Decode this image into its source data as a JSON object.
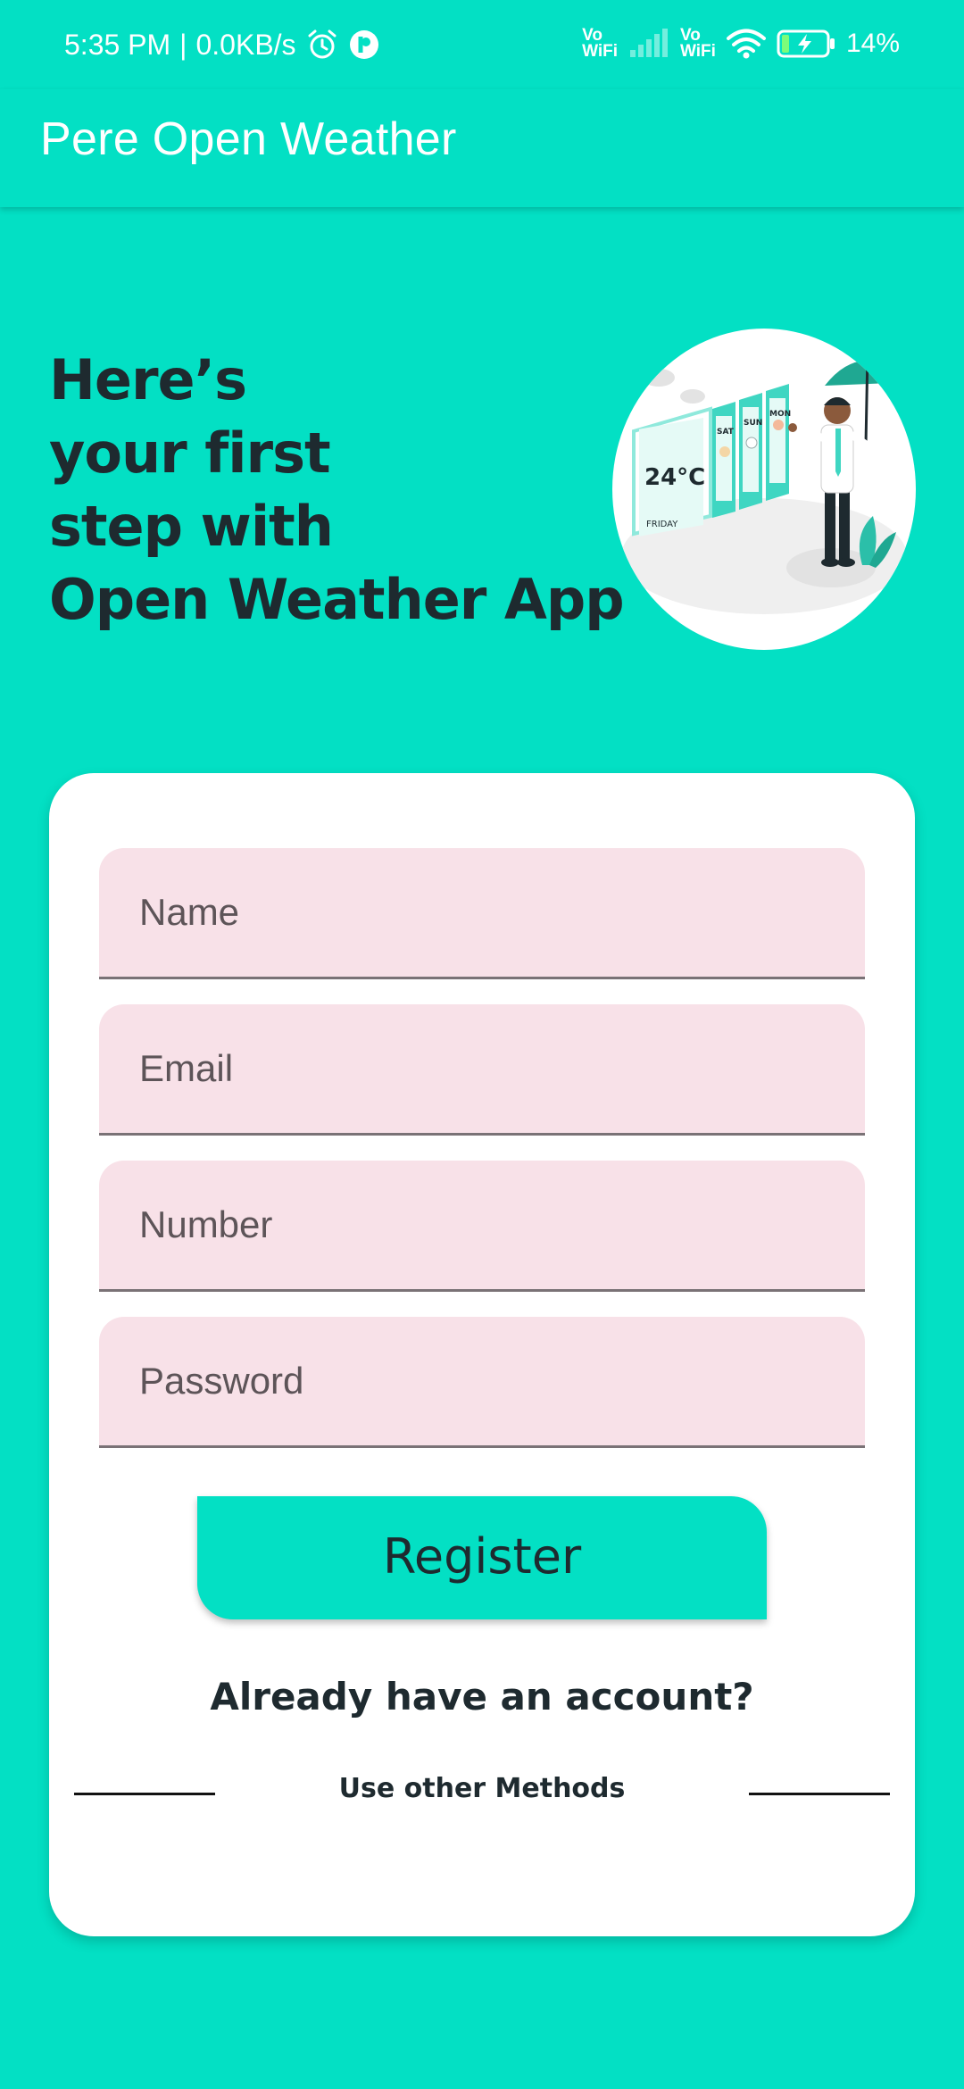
{
  "status_bar": {
    "time": "5:35 PM",
    "separator": "|",
    "network_speed": "0.0KB/s",
    "volte_top": "Vo",
    "volte_bottom": "WiFi",
    "battery_percent": "14%",
    "icons": [
      "alarm-icon",
      "app-notification-icon",
      "signal-icon",
      "wifi-icon",
      "battery-charging-icon"
    ]
  },
  "app_bar": {
    "title": "Pere Open Weather"
  },
  "hero": {
    "heading": "Here’s\nyour first\nstep with\nOpen Weather App",
    "illustration": {
      "temperature": "24°C",
      "days": [
        "SAT",
        "SUN",
        "MON"
      ],
      "current_day": "FRIDAY"
    }
  },
  "form": {
    "name_placeholder": "Name",
    "email_placeholder": "Email",
    "number_placeholder": "Number",
    "password_placeholder": "Password",
    "register_label": "Register",
    "login_link": "Already have an account?",
    "other_methods": "Use other Methods"
  },
  "colors": {
    "primary": "#03E0C4",
    "field_background": "#F8E1E8",
    "heading_text": "#1E2A2F",
    "card": "#FFFFFF"
  }
}
